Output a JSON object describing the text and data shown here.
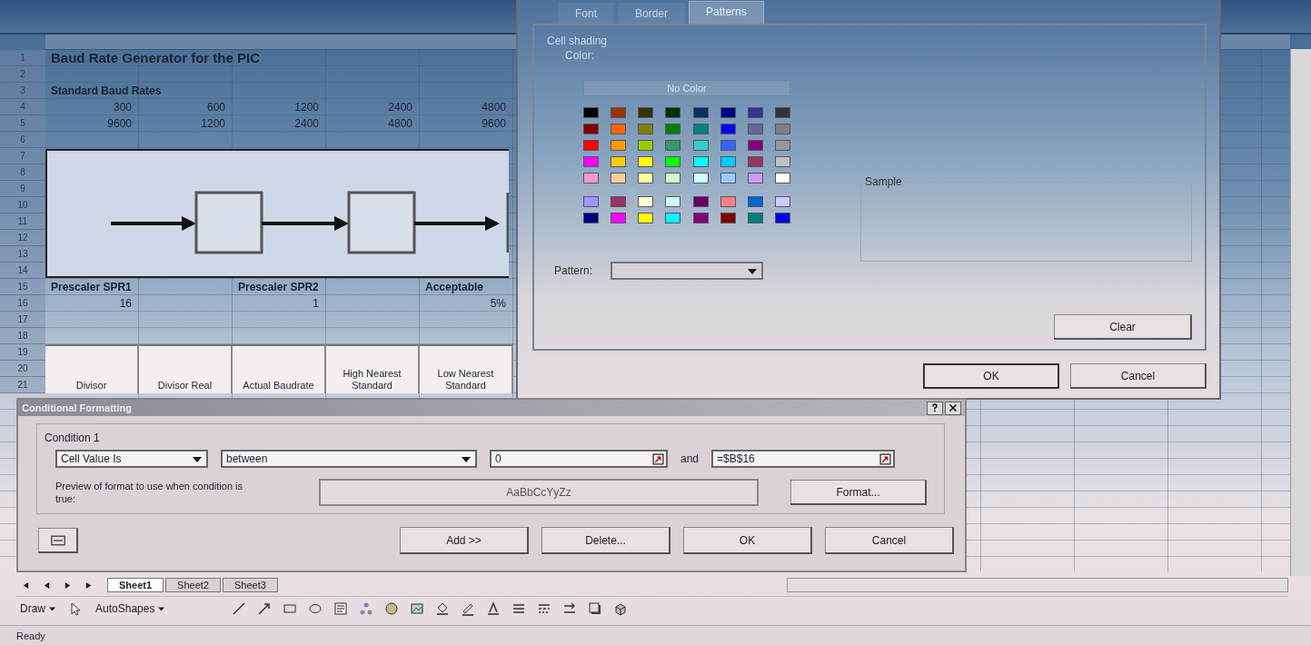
{
  "sheet": {
    "row_numbers": [
      "1",
      "2",
      "3",
      "4",
      "5",
      "6",
      "7",
      "8",
      "9",
      "10",
      "11",
      "12",
      "13",
      "14",
      "15",
      "16",
      "17",
      "18",
      "19",
      "20",
      "21"
    ],
    "title": "Baud Rate Generator for the PIC",
    "section_label": "Standard Baud Rates",
    "baud_rows": [
      [
        "300",
        "600",
        "1200",
        "2400",
        "4800"
      ],
      [
        "9600",
        "1200",
        "2400",
        "4800",
        "9600"
      ]
    ],
    "prescaler_labels": [
      "Prescaler SPR1",
      "Prescaler SPR2",
      "Acceptable"
    ],
    "prescaler_values": [
      "16",
      "1",
      "5%"
    ],
    "column_headings": [
      "Divisor",
      "Divisor Real",
      "Actual Baudrate",
      "High Nearest Standard",
      "Low Nearest Standard"
    ]
  },
  "format_cells": {
    "tabs": [
      {
        "label": "Font",
        "selected": false
      },
      {
        "label": "Border",
        "selected": false
      },
      {
        "label": "Patterns",
        "selected": true
      }
    ],
    "group": "Cell shading",
    "color_label": "Color:",
    "no_color": "No Color",
    "palette": [
      {
        "color": "#000000"
      },
      {
        "color": "#993300"
      },
      {
        "color": "#333300"
      },
      {
        "color": "#003300"
      },
      {
        "color": "#003366"
      },
      {
        "color": "#000080"
      },
      {
        "color": "#333399"
      },
      {
        "color": "#333333"
      },
      {
        "color": "#800000"
      },
      {
        "color": "#ff6600"
      },
      {
        "color": "#808000"
      },
      {
        "color": "#008000"
      },
      {
        "color": "#008080"
      },
      {
        "color": "#0000ff"
      },
      {
        "color": "#666699"
      },
      {
        "color": "#808080"
      },
      {
        "color": "#ff0000"
      },
      {
        "color": "#ff9900"
      },
      {
        "color": "#99cc00"
      },
      {
        "color": "#339966"
      },
      {
        "color": "#33cccc"
      },
      {
        "color": "#3366ff"
      },
      {
        "color": "#800080"
      },
      {
        "color": "#969696"
      },
      {
        "color": "#ff00ff"
      },
      {
        "color": "#ffcc00"
      },
      {
        "color": "#ffff00"
      },
      {
        "color": "#00ff00"
      },
      {
        "color": "#00ffff"
      },
      {
        "color": "#00ccff"
      },
      {
        "color": "#993366"
      },
      {
        "color": "#c0c0c0"
      },
      {
        "color": "#ff99cc"
      },
      {
        "color": "#ffcc99"
      },
      {
        "color": "#ffff99"
      },
      {
        "color": "#ccffcc"
      },
      {
        "color": "#ccffff"
      },
      {
        "color": "#99ccff"
      },
      {
        "color": "#cc99ff"
      },
      {
        "color": "#ffffff"
      },
      {
        "color": "#9999ff"
      },
      {
        "color": "#993366"
      },
      {
        "color": "#ffffcc"
      },
      {
        "color": "#ccffff"
      },
      {
        "color": "#660066"
      },
      {
        "color": "#ff8080"
      },
      {
        "color": "#0066cc"
      },
      {
        "color": "#ccccff"
      },
      {
        "color": "#000080"
      },
      {
        "color": "#ff00ff"
      },
      {
        "color": "#ffff00"
      },
      {
        "color": "#00ffff"
      },
      {
        "color": "#800080"
      },
      {
        "color": "#800000"
      },
      {
        "color": "#008080"
      },
      {
        "color": "#0000ff"
      }
    ],
    "pattern_label": "Pattern:",
    "sample_label": "Sample",
    "clear_button": "Clear",
    "buttons": [
      "OK",
      "Cancel"
    ]
  },
  "conditional": {
    "title": "Conditional Formatting",
    "condition": "Condition 1",
    "operand_type": "Cell Value Is",
    "operator": "between",
    "value1": "0",
    "and_label": "and",
    "value2": "=$B$16",
    "preview_label": "Preview of format to use when condition is true:",
    "preview": "AaBbCcYyZz",
    "format_button": "Format...",
    "buttons": [
      "Add >>",
      "Delete...",
      "OK",
      "Cancel"
    ]
  },
  "sheet_tabs": [
    {
      "label": "Sheet1",
      "selected": true
    },
    {
      "label": "Sheet2",
      "selected": false
    },
    {
      "label": "Sheet3",
      "selected": false
    }
  ],
  "drawing_toolbar": {
    "draw": "Draw",
    "autoshapes": "AutoShapes"
  },
  "status_bar": "Ready"
}
